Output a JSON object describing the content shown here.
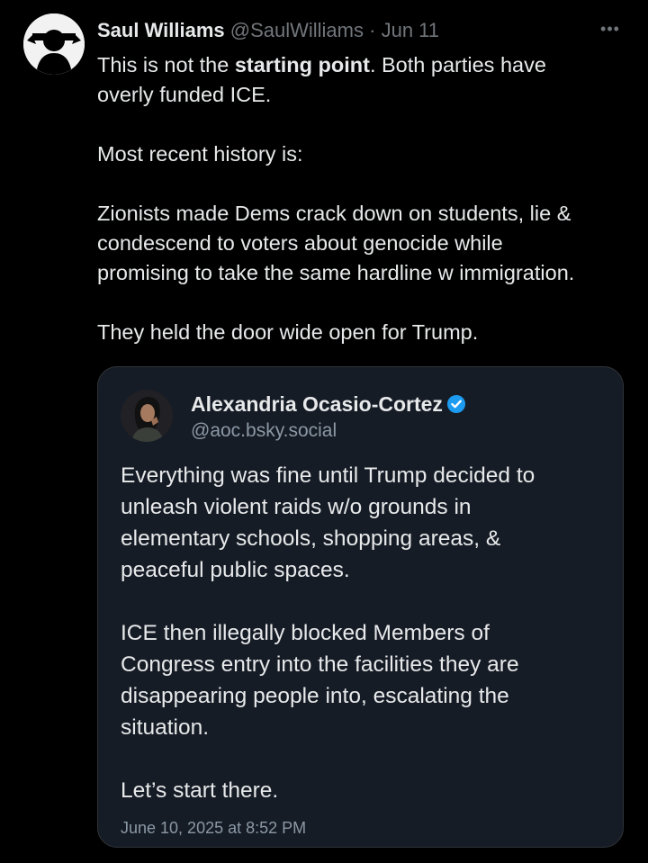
{
  "post": {
    "author_name": "Saul Williams",
    "author_handle": "@SaulWilliams",
    "separator": "·",
    "date": "Jun 11",
    "more_label": "•••",
    "text": {
      "line1_before": "This is not the ",
      "line1_bold": "starting point",
      "line1_after": ".  Both parties have",
      "line2": "overly funded ICE.",
      "para2": "Most recent history is:",
      "para3_line1": "Zionists made Dems crack down on students, lie &",
      "para3_line2": "condescend to voters about genocide while",
      "para3_line3": "promising to take the same hardline w immigration.",
      "para4": "They held the door wide open for Trump."
    }
  },
  "quote": {
    "author_name": "Alexandria Ocasio-Cortez",
    "author_handle": "@aoc.bsky.social",
    "verified_icon": "verified-badge-icon",
    "text": {
      "p1_line1": "Everything was fine until Trump decided to",
      "p1_line2": "unleash violent raids w/o grounds in",
      "p1_line3": "elementary schools, shopping areas, &",
      "p1_line4": "peaceful public spaces.",
      "p2_line1": "ICE then illegally blocked Members of",
      "p2_line2": "Congress entry into the facilities they are",
      "p2_line3": "disappearing people into, escalating the",
      "p2_line4": "situation.",
      "p3": "Let’s start there."
    },
    "timestamp": "June 10, 2025 at 8:52 PM"
  },
  "colors": {
    "background": "#000000",
    "text_primary": "#e7e9ea",
    "text_secondary": "#71767b",
    "quote_background": "#161c26",
    "verified_blue": "#1d9bf0"
  }
}
